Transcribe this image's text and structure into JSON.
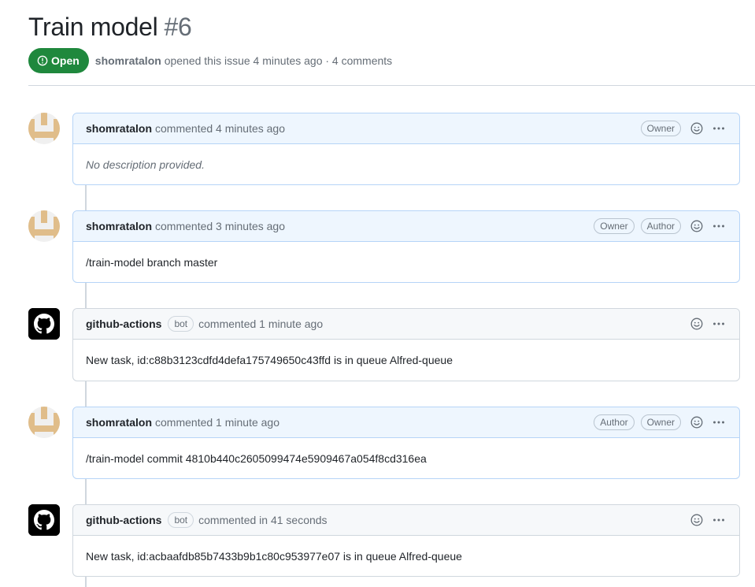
{
  "issue": {
    "title": "Train model",
    "number": "#6",
    "state": "Open",
    "author": "shomratalon",
    "opened_text": "opened this issue 4 minutes ago · 4 comments"
  },
  "comments": [
    {
      "author": "shomratalon",
      "action": "commented 4 minutes ago",
      "labels": [
        "Owner"
      ],
      "body": "No description provided."
    },
    {
      "author": "shomratalon",
      "action": "commented 3 minutes ago",
      "labels": [
        "Owner",
        "Author"
      ],
      "body": "/train-model branch master"
    },
    {
      "author": "github-actions",
      "bot_label": "bot",
      "action": "commented 1 minute ago",
      "labels": [],
      "body": "New task, id:c88b3123cdfd4defa175749650c43ffd is in queue Alfred-queue"
    },
    {
      "author": "shomratalon",
      "action": "commented 1 minute ago",
      "labels": [
        "Author",
        "Owner"
      ],
      "body": "/train-model commit 4810b440c2605099474e5909467a054f8cd316ea"
    },
    {
      "author": "github-actions",
      "bot_label": "bot",
      "action": "commented in 41 seconds",
      "labels": [],
      "body": "New task, id:acbaafdb85b7433b9b1c80c953977e07 is in queue Alfred-queue"
    }
  ],
  "icons": {
    "state": "issue-opened-icon",
    "reaction": "smiley-icon",
    "menu": "kebab-horizontal-icon",
    "user_avatar": "identicon-avatar",
    "bot_avatar": "github-mark-icon"
  },
  "colors": {
    "open_green": "#1f883d",
    "own_comment_header": "#eef6fe",
    "own_comment_border": "#b6d4f7",
    "identicon": "#e0bd8a"
  }
}
